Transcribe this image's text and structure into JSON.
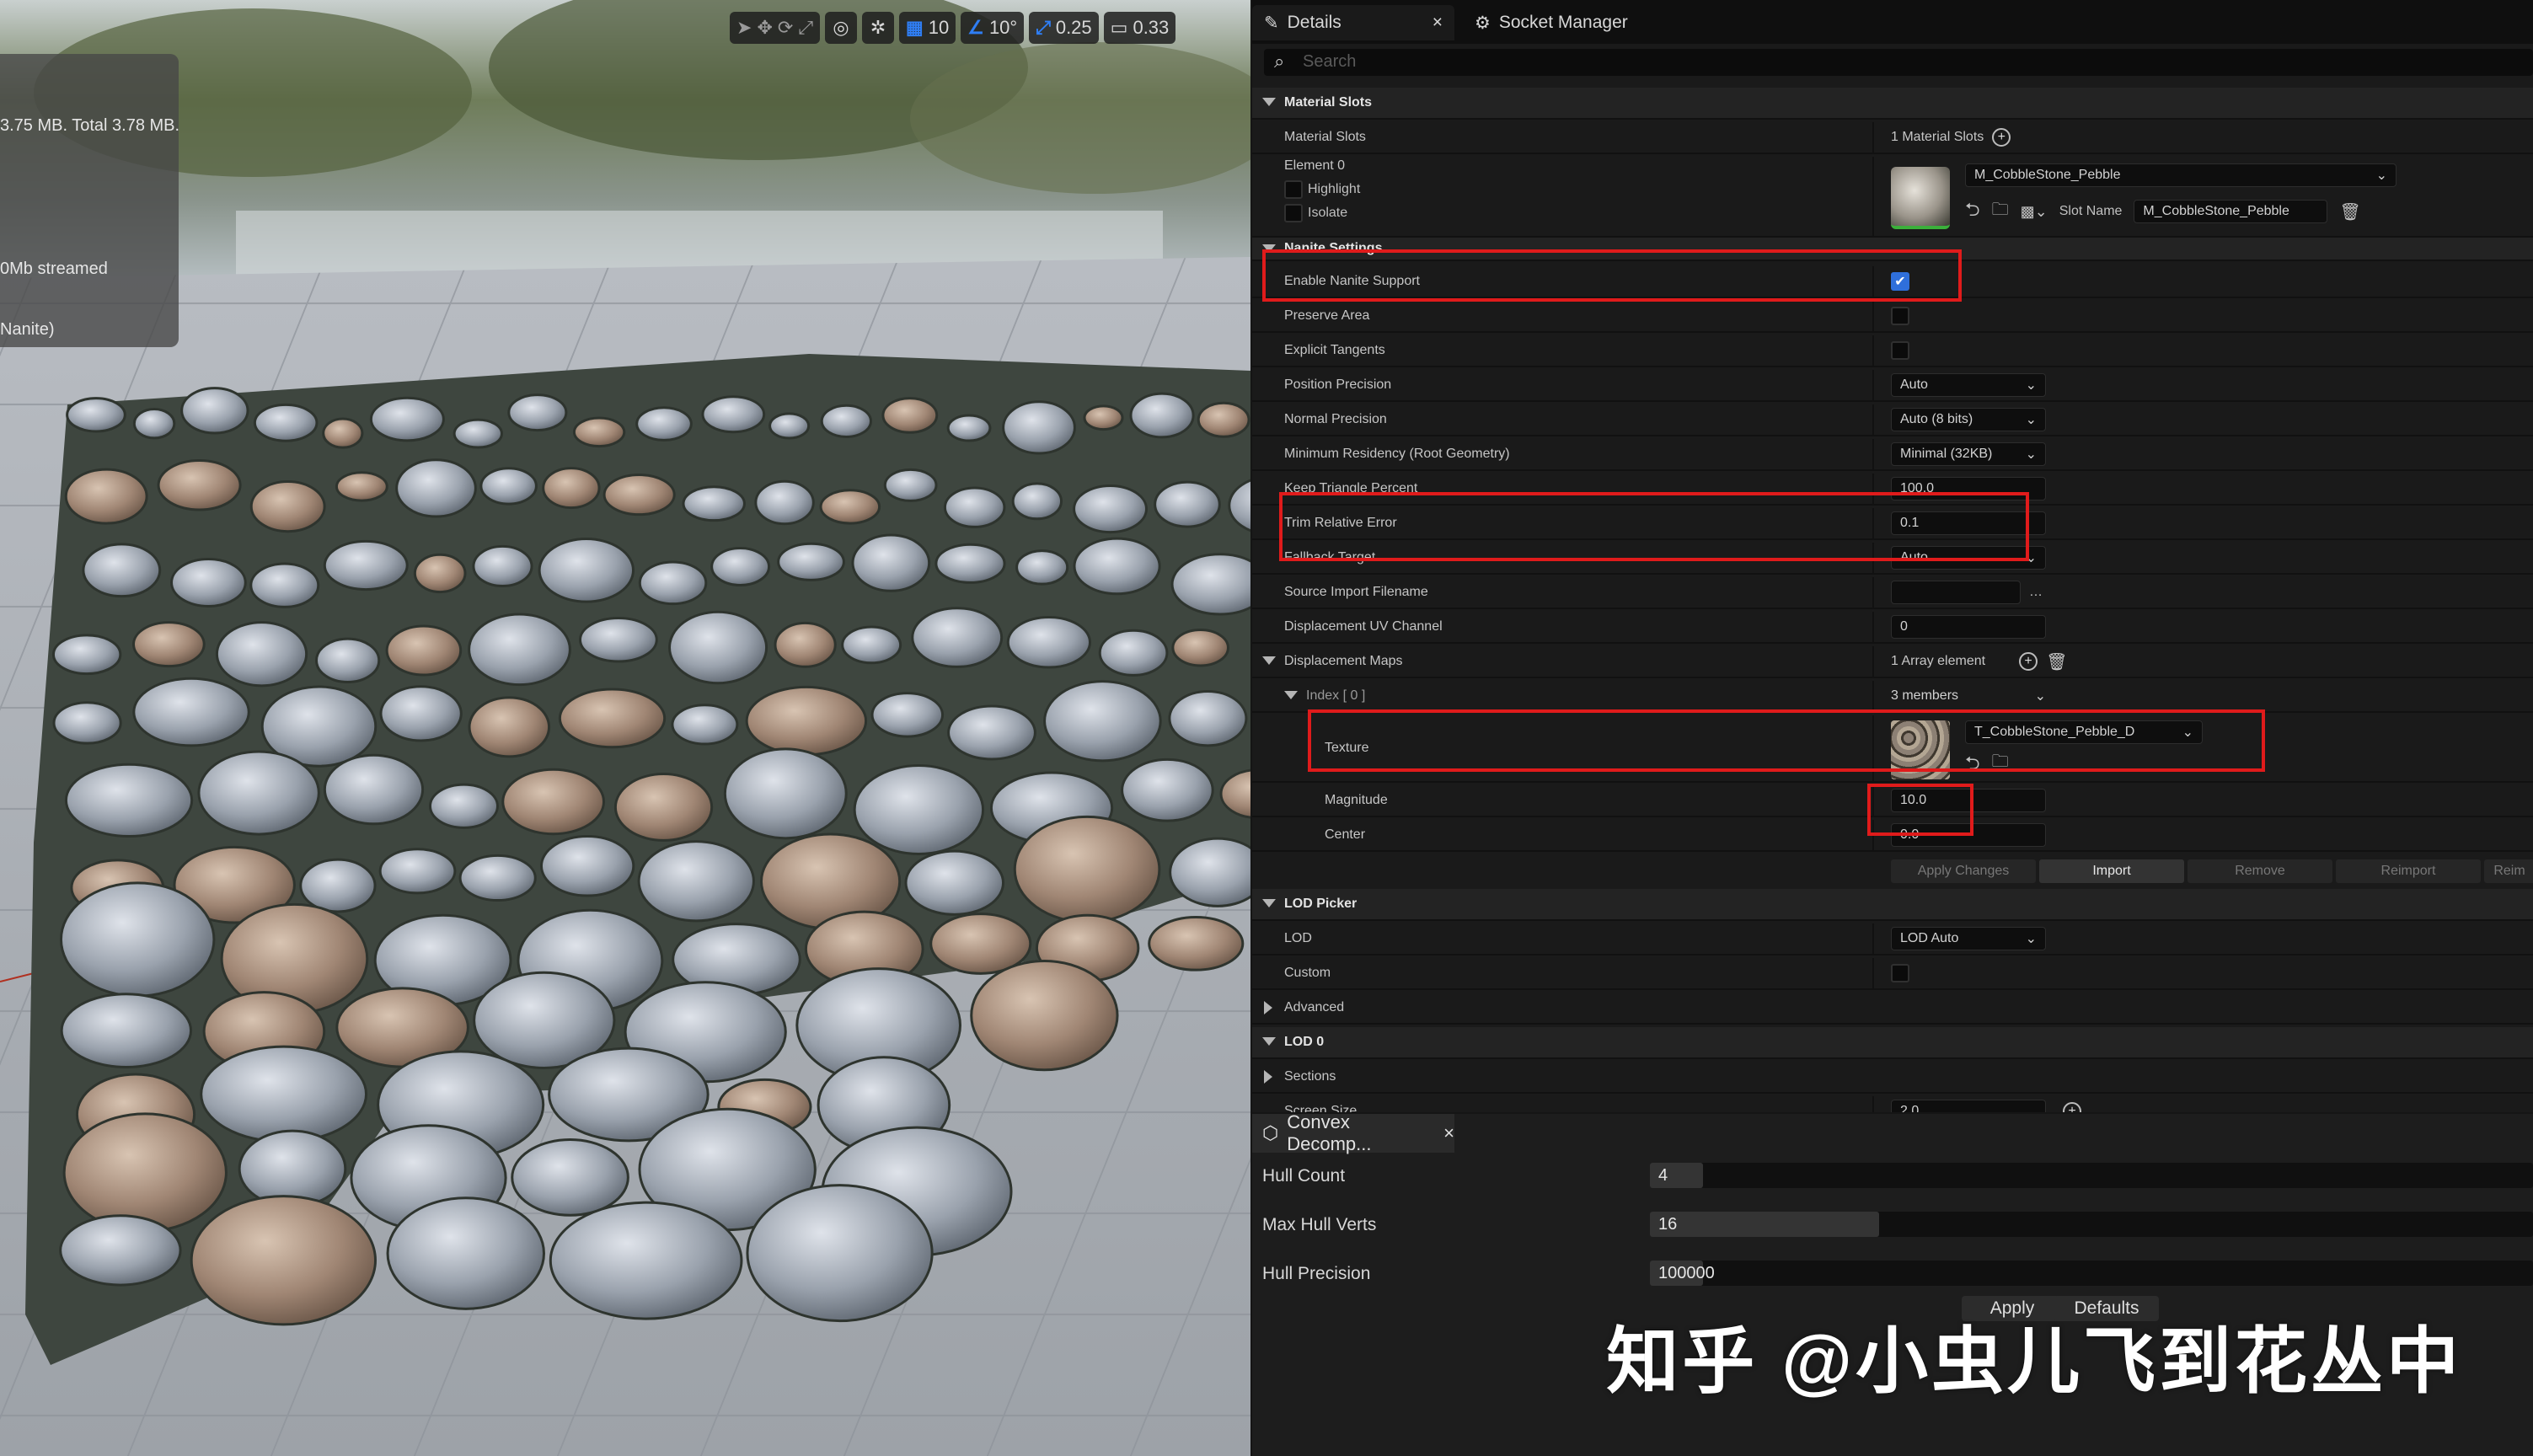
{
  "viewport": {
    "stats": [
      "3.75 MB. Total 3.78 MB.",
      "0Mb streamed",
      "Nanite)"
    ],
    "toolbar": {
      "grid_snap": "10",
      "rotation_snap": "10°",
      "scale_snap": "0.25",
      "camera_speed": "0.33"
    }
  },
  "details": {
    "tabs": {
      "details": "Details",
      "socket_manager": "Socket Manager"
    },
    "search_placeholder": "Search",
    "material_slots": {
      "header": "Material Slots",
      "label": "Material Slots",
      "count": "1 Material Slots",
      "element": "Element 0",
      "highlight": "Highlight",
      "isolate": "Isolate",
      "material": "M_CobbleStone_Pebble",
      "slot_name_label": "Slot Name",
      "slot_name": "M_CobbleStone_Pebble"
    },
    "nanite": {
      "header": "Nanite Settings",
      "enable_label": "Enable Nanite Support",
      "enable_value": true,
      "preserve_area": "Preserve Area",
      "explicit_tangents": "Explicit Tangents",
      "position_precision": "Position Precision",
      "position_precision_value": "Auto",
      "normal_precision": "Normal Precision",
      "normal_precision_value": "Auto (8 bits)",
      "min_residency": "Minimum Residency (Root Geometry)",
      "min_residency_value": "Minimal (32KB)",
      "keep_triangle": "Keep Triangle Percent",
      "keep_triangle_value": "100.0",
      "trim_error": "Trim Relative Error",
      "trim_error_value": "0.1",
      "fallback_target": "Fallback Target",
      "fallback_target_value": "Auto",
      "source_import": "Source Import Filename",
      "disp_uv": "Displacement UV Channel",
      "disp_uv_value": "0",
      "disp_maps": "Displacement Maps",
      "disp_maps_count": "1 Array element",
      "index": "Index [ 0 ]",
      "index_members": "3 members",
      "texture": "Texture",
      "texture_value": "T_CobbleStone_Pebble_D",
      "magnitude": "Magnitude",
      "magnitude_value": "10.0",
      "center": "Center",
      "center_value": "0.0",
      "buttons": [
        "Apply Changes",
        "Import",
        "Remove",
        "Reimport",
        "Reim"
      ]
    },
    "lod_picker": {
      "header": "LOD Picker",
      "lod": "LOD",
      "lod_value": "LOD Auto",
      "custom": "Custom",
      "advanced": "Advanced"
    },
    "lod0": {
      "header": "LOD 0",
      "sections": "Sections",
      "screen_size": "Screen Size",
      "screen_size_value": "2.0"
    }
  },
  "convex": {
    "tab": "Convex Decomp...",
    "rows": [
      {
        "label": "Hull Count",
        "value": "4",
        "fill": 0.06
      },
      {
        "label": "Max Hull Verts",
        "value": "16",
        "fill": 0.26
      },
      {
        "label": "Hull Precision",
        "value": "100000",
        "fill": 0.06
      }
    ],
    "apply": "Apply",
    "defaults": "Defaults"
  },
  "watermark": "知乎 @小虫儿飞到花丛中"
}
